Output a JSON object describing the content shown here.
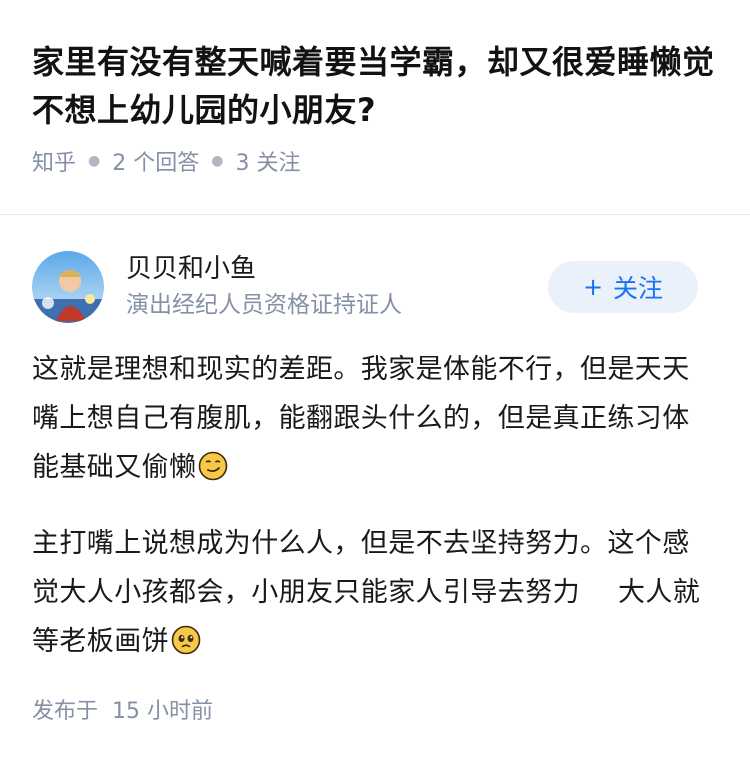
{
  "question": {
    "title": "家里有没有整天喊着要当学霸，却又很爱睡懒觉不想上幼儿园的小朋友?",
    "meta": {
      "source": "知乎",
      "answers_label": "2 个回答",
      "follows_label": "3 关注"
    }
  },
  "answer": {
    "author": {
      "name": "贝贝和小鱼",
      "credential": "演出经纪人员资格证持证人",
      "avatar_icon": "avatar-image"
    },
    "follow_button": {
      "plus": "+",
      "label": "关注"
    },
    "paragraphs": [
      {
        "text": "这就是理想和现实的差距。我家是体能不行，但是天天嘴上想自己有腹肌，能翻跟头什么的，但是真正练习体能基础又偷懒",
        "emoji": "smirk-emoji"
      },
      {
        "text_before": "主打嘴上说想成为什么人，但是不去坚持努力。这个感觉大人小孩都会，小朋友只能家人引导去努力",
        "text_after": "大人就等老板画饼",
        "emoji": "pleading-emoji"
      }
    ],
    "footer": {
      "published_label": "发布于",
      "time": "15 小时前"
    }
  },
  "colors": {
    "accent": "#1772f6",
    "button_bg": "#eaf1fb",
    "meta_text": "#8590a6"
  }
}
